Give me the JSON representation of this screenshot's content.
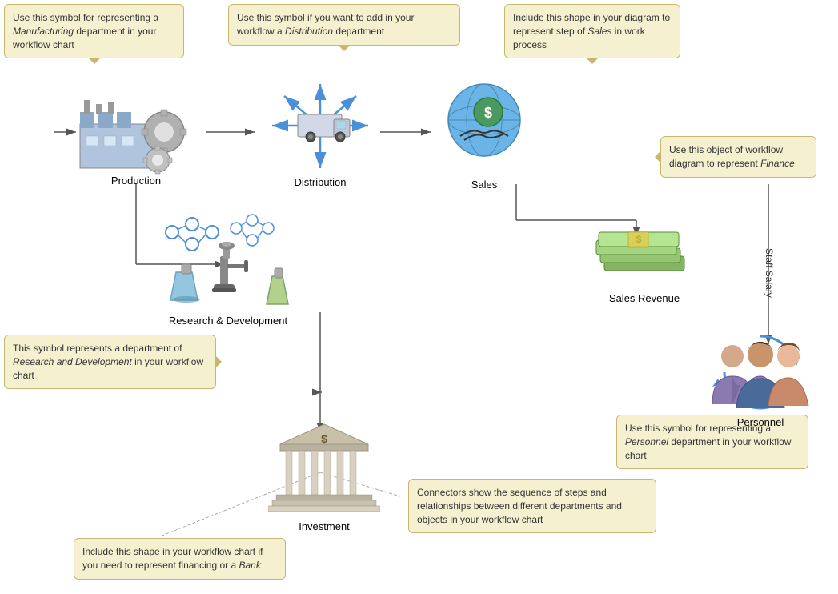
{
  "tooltips": {
    "manufacturing": {
      "text_parts": [
        "Use this symbol for representing a ",
        "Manufacturing",
        " department in your workflow chart"
      ],
      "italic": [
        false,
        true,
        false
      ]
    },
    "distribution": {
      "text_parts": [
        "Use this symbol if you want to add in your workflow a ",
        "Distribution",
        " department"
      ],
      "italic": [
        false,
        true,
        false
      ]
    },
    "sales": {
      "text_parts": [
        "Include this shape in your diagram to represent step of ",
        "Sales",
        " in work process"
      ],
      "italic": [
        false,
        true,
        false
      ]
    },
    "finance": {
      "text_parts": [
        "Use this object of workflow diagram to represent ",
        "Finance"
      ],
      "italic": [
        false,
        true
      ]
    },
    "rd": {
      "text_parts": [
        "This symbol represents a department of ",
        "Research and Development",
        " in your workflow chart"
      ],
      "italic": [
        false,
        true,
        false
      ]
    },
    "personnel": {
      "text_parts": [
        "Use this symbol for representing a ",
        "Personnel",
        " department in your workflow chart"
      ],
      "italic": [
        false,
        true,
        false
      ]
    },
    "connectors": {
      "text_parts": [
        "Connectors show the sequence of steps and relationships between different departments and objects in your workflow chart"
      ],
      "italic": [
        false
      ]
    },
    "bank": {
      "text_parts": [
        "Include this shape in your workflow chart if you need to represent financing or a ",
        "Bank"
      ],
      "italic": [
        false,
        true
      ]
    }
  },
  "nodes": {
    "production": {
      "label": "Production"
    },
    "distribution": {
      "label": "Distribution"
    },
    "sales": {
      "label": "Sales"
    },
    "sales_revenue": {
      "label": "Sales Revenue"
    },
    "rd": {
      "label": "Research & Development"
    },
    "investment": {
      "label": "Investment"
    },
    "personnel": {
      "label": "Personnel"
    }
  },
  "connectors": {
    "staff_salary": "Staff Salary"
  }
}
